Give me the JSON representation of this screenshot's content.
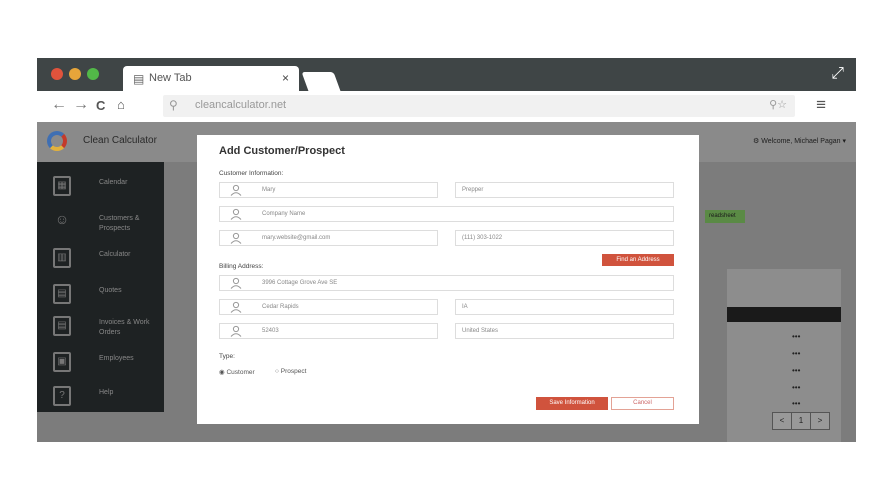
{
  "browser": {
    "tab_title": "New Tab",
    "tab_close": "×",
    "url": "cleancalculator.net"
  },
  "app": {
    "name": "Clean Calculator",
    "welcome": "Welcome, Michael Pagan",
    "sidebar": [
      {
        "label": "Calendar"
      },
      {
        "label": "Customers & Prospects"
      },
      {
        "label": "Calculator"
      },
      {
        "label": "Quotes"
      },
      {
        "label": "Invoices & Work Orders"
      },
      {
        "label": "Employees"
      },
      {
        "label": "Help"
      }
    ],
    "bg_button": "readsheet",
    "row_menu": "•••",
    "pager": [
      "<",
      "1",
      ">"
    ]
  },
  "modal": {
    "title": "Add Customer/Prospect",
    "customer_info_label": "Customer Information:",
    "first_name": "Mary",
    "last_name": "Prepper",
    "company_placeholder": "Company Name",
    "email": "mary.website@gmail.com",
    "phone": "(111) 303-1022",
    "find_address": "Find an Address",
    "billing_label": "Billing Address:",
    "street": "3996 Cottage Grove Ave SE",
    "city": "Cedar Rapids",
    "state": "IA",
    "zip": "52403",
    "country": "United States",
    "type_label": "Type:",
    "type_options": [
      "Customer",
      "Prospect"
    ],
    "save_label": "Save Information",
    "cancel_label": "Cancel"
  }
}
